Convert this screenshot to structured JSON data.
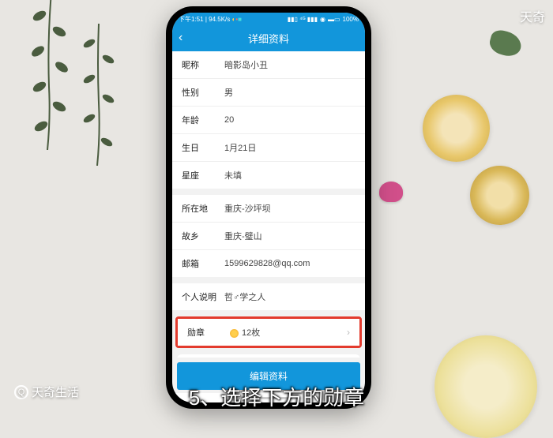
{
  "status": {
    "time": "下午1:51",
    "net": "94.5K/s",
    "battery": "100%"
  },
  "nav": {
    "title": "详细资料"
  },
  "profile": {
    "nickname_label": "昵称",
    "nickname_value": "暗影岛小丑",
    "gender_label": "性别",
    "gender_value": "男",
    "age_label": "年龄",
    "age_value": "20",
    "birthday_label": "生日",
    "birthday_value": "1月21日",
    "zodiac_label": "星座",
    "zodiac_value": "未填"
  },
  "location": {
    "current_label": "所在地",
    "current_value": "重庆-沙坪坝",
    "hometown_label": "故乡",
    "hometown_value": "重庆-璧山",
    "email_label": "邮箱",
    "email_value": "1599629828@qq.com"
  },
  "bio": {
    "label": "个人说明",
    "value": "哲♂学之人"
  },
  "medals": {
    "label": "勋章",
    "count": "12枚"
  },
  "bottom_button": "编辑资料",
  "watermark_tr": "天奇",
  "watermark_bl": "天奇生活",
  "caption": "5、选择下方的勋章"
}
